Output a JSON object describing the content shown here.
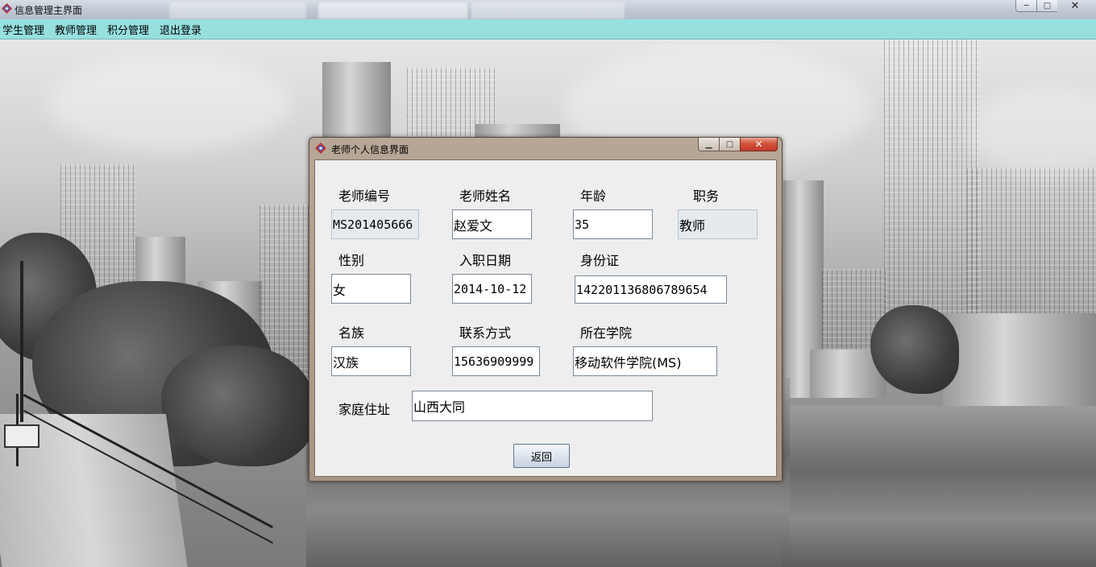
{
  "main_window": {
    "title": "信息管理主界面",
    "controls": {
      "minimize": "─",
      "maximize": "□",
      "close": "✕"
    }
  },
  "menubar": {
    "items": [
      "学生管理",
      "教师管理",
      "积分管理",
      "退出登录"
    ]
  },
  "dialog": {
    "title": "老师个人信息界面",
    "controls": {
      "minimize": "▁",
      "maximize": "□",
      "close": "✕"
    },
    "labels": {
      "teacher_id": "老师编号",
      "teacher_name": "老师姓名",
      "age": "年龄",
      "position": "职务",
      "gender": "性别",
      "hire_date": "入职日期",
      "id_card": "身份证",
      "ethnicity": "名族",
      "contact": "联系方式",
      "college": "所在学院",
      "address": "家庭住址"
    },
    "values": {
      "teacher_id": "MS201405666",
      "teacher_name": "赵爱文",
      "age": "35",
      "position": "教师",
      "gender": "女",
      "hire_date": "2014-10-12",
      "id_card": "142201136806789654",
      "ethnicity": "汉族",
      "contact": "15636909999",
      "college": "移动软件学院(MS)",
      "address": "山西大同"
    },
    "return_button": "返回"
  }
}
